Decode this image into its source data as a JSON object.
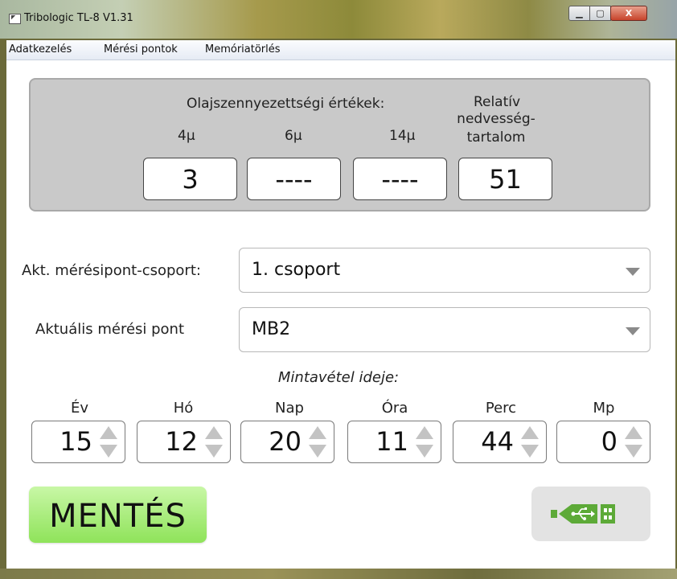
{
  "window": {
    "title": "Tribologic TL-8 V1.31",
    "min_label": "▁",
    "max_label": "▢",
    "close_label": "X"
  },
  "menu": {
    "items": [
      "Adatkezelés",
      "Mérési pontok",
      "Memóriatörlés"
    ]
  },
  "readings": {
    "title": "Olajszennyezettségi értékek:",
    "humidity_title_1": "Relatív",
    "humidity_title_2": "nedvesség-",
    "humidity_title_3": "tartalom",
    "labels": [
      "4µ",
      "6µ",
      "14µ"
    ],
    "values": [
      "3",
      "----",
      "----",
      "51"
    ]
  },
  "group": {
    "label": "Akt. mérésipont-csoport:",
    "value": "1. csoport"
  },
  "point": {
    "label": "Aktuális mérési pont",
    "value": "MB2"
  },
  "sampling": {
    "caption": "Mintavétel ideje:",
    "fields": [
      {
        "label": "Év",
        "value": "15"
      },
      {
        "label": "Hó",
        "value": "12"
      },
      {
        "label": "Nap",
        "value": "20"
      },
      {
        "label": "Óra",
        "value": "11"
      },
      {
        "label": "Perc",
        "value": "44"
      },
      {
        "label": "Mp",
        "value": "0"
      }
    ]
  },
  "actions": {
    "save_label": "MENTÉS",
    "usb_icon": "usb-icon"
  },
  "colors": {
    "save_green": "#8fe35a",
    "usb_green": "#5daa38",
    "panel_gray": "#c9c9c9"
  }
}
